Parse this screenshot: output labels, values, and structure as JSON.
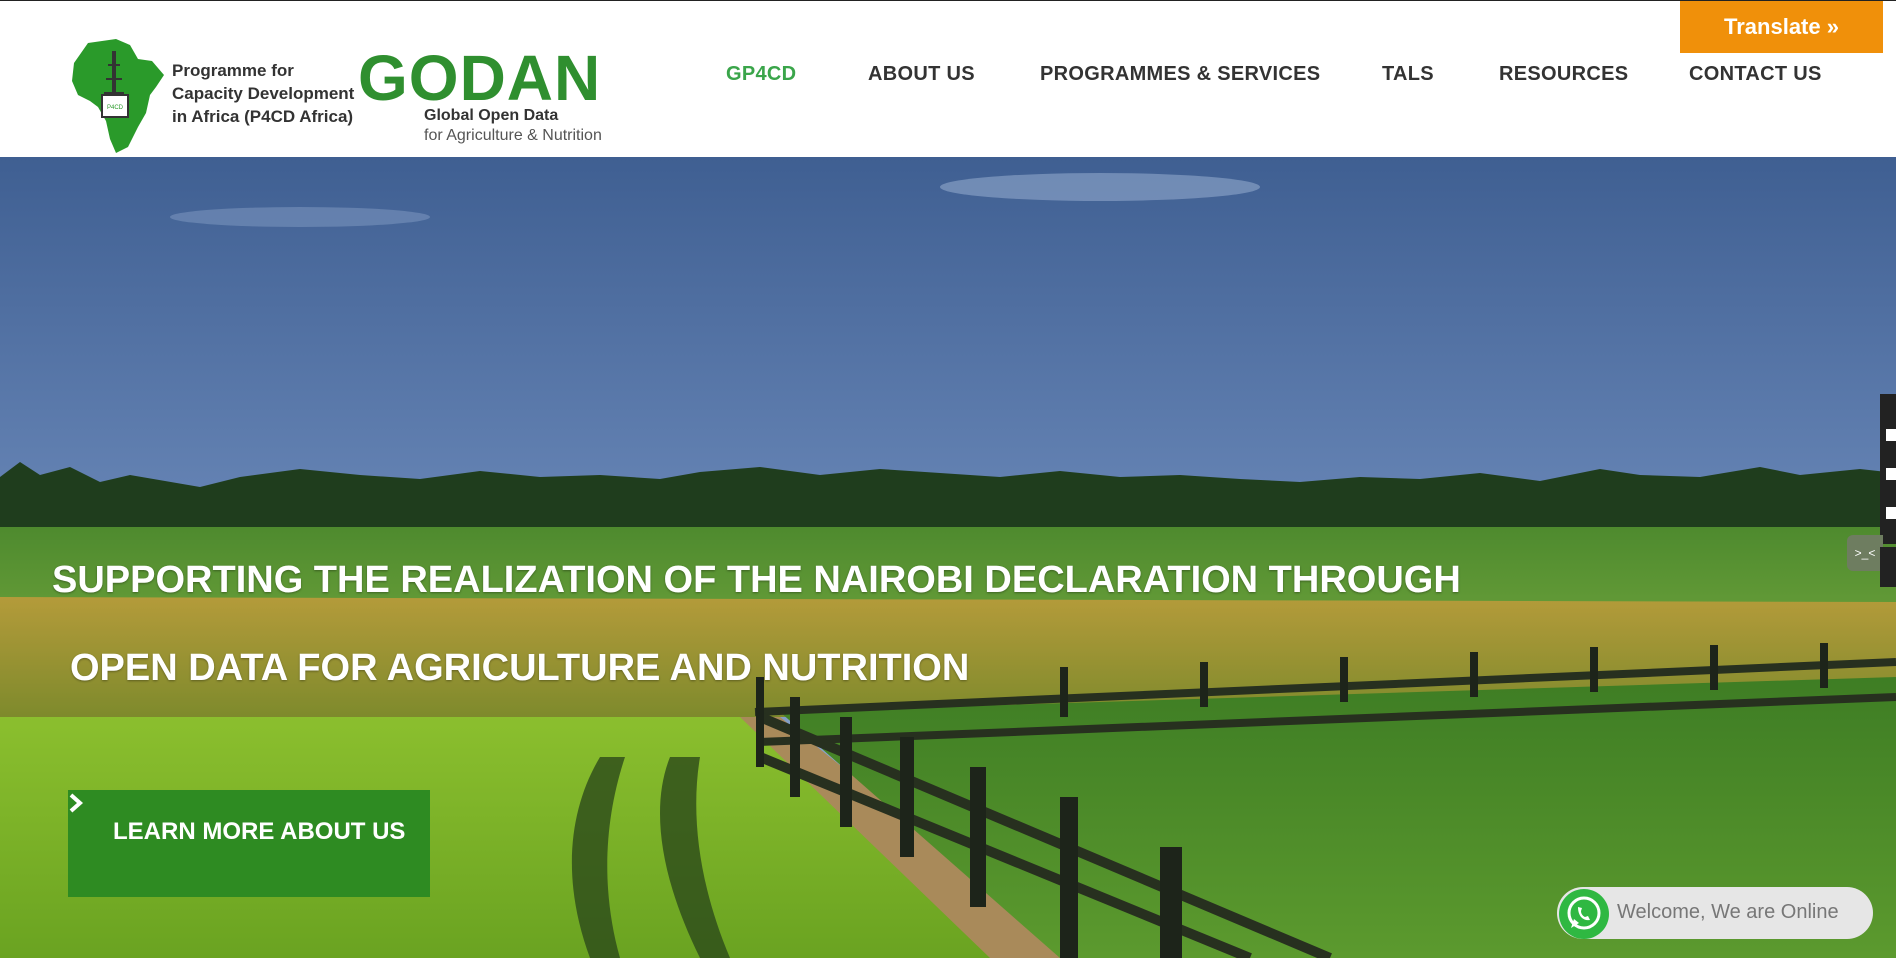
{
  "header": {
    "p4cd_lines": [
      "Programme for",
      "Capacity Development",
      "in Africa (P4CD Africa)"
    ],
    "godan_word": "GODAN",
    "godan_sub1": "Global Open Data",
    "godan_sub2": "for Agriculture & Nutrition"
  },
  "translate_label": "Translate »",
  "nav": [
    {
      "label": "GP4CD",
      "active": true
    },
    {
      "label": "ABOUT US"
    },
    {
      "label": "PROGRAMMES & SERVICES"
    },
    {
      "label": "TALS"
    },
    {
      "label": "RESOURCES"
    },
    {
      "label": "CONTACT US"
    }
  ],
  "hero": {
    "headline_1": "SUPPORTING THE REALIZATION OF THE NAIROBI DECLARATION THROUGH",
    "headline_2": "OPEN DATA FOR AGRICULTURE AND NUTRITION",
    "cta_label": "LEARN MORE ABOUT US"
  },
  "side_toggle_label": ">_<",
  "whatsapp": {
    "message": "Welcome, We are Online"
  },
  "colors": {
    "accent_green": "#3aa54a",
    "cta_green": "#2e8b22",
    "translate_orange": "#f0900a",
    "godan_green": "#2f8f2f"
  }
}
